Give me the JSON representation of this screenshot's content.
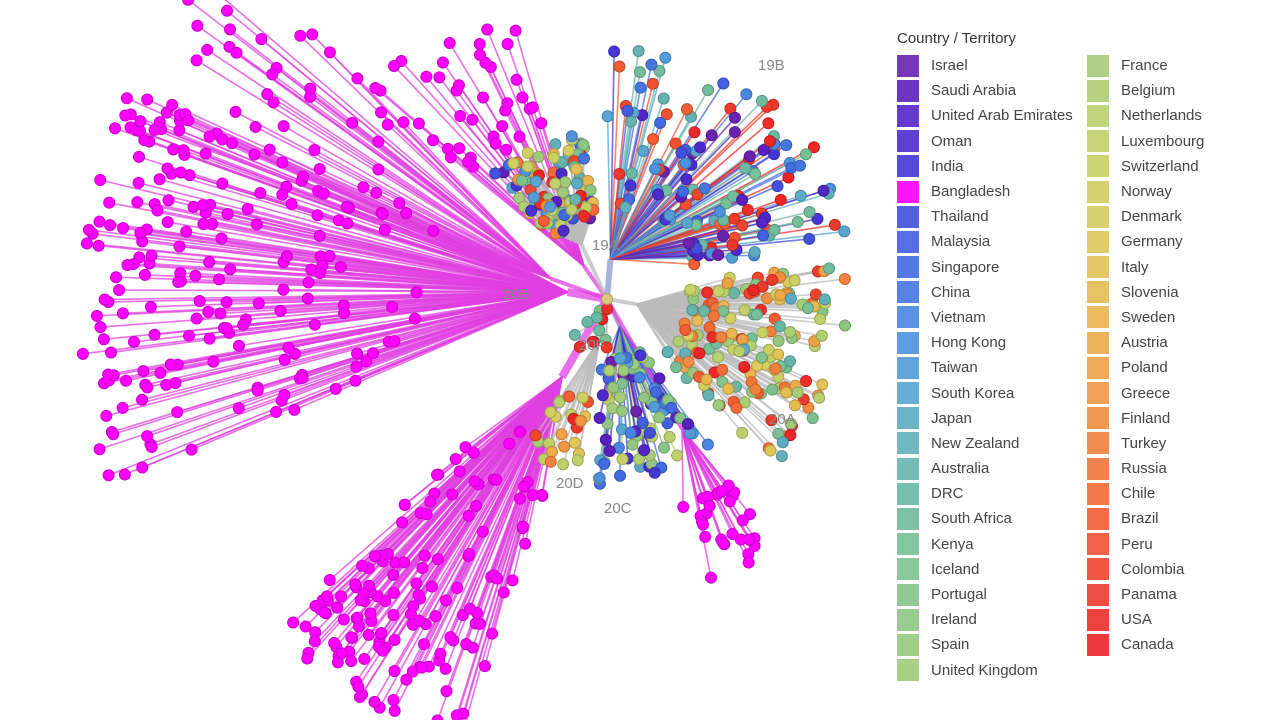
{
  "legend": {
    "title": "Country / Territory",
    "columns": [
      [
        {
          "label": "Israel",
          "color": "#6a22b0"
        },
        {
          "label": "Saudi Arabia",
          "color": "#5b1fbd"
        },
        {
          "label": "United Arab Emirates",
          "color": "#5426c5"
        },
        {
          "label": "Oman",
          "color": "#4b2ccb"
        },
        {
          "label": "India",
          "color": "#4637d4"
        },
        {
          "label": "Bangladesh",
          "color": "#ff00ff"
        },
        {
          "label": "Thailand",
          "color": "#4250db"
        },
        {
          "label": "Malaysia",
          "color": "#435fe0"
        },
        {
          "label": "Singapore",
          "color": "#436ae2"
        },
        {
          "label": "China",
          "color": "#4577df"
        },
        {
          "label": "Vietnam",
          "color": "#4a86e0"
        },
        {
          "label": "Hong Kong",
          "color": "#4e92de"
        },
        {
          "label": "Taiwan",
          "color": "#539cd8"
        },
        {
          "label": "South Korea",
          "color": "#58a5d0"
        },
        {
          "label": "Japan",
          "color": "#5dabc4"
        },
        {
          "label": "New Zealand",
          "color": "#62b0b8"
        },
        {
          "label": "Australia",
          "color": "#66b4ad"
        },
        {
          "label": "DRC",
          "color": "#6bb9a5"
        },
        {
          "label": "South Africa",
          "color": "#70bc9d"
        },
        {
          "label": "Kenya",
          "color": "#77bf96"
        },
        {
          "label": "Iceland",
          "color": "#7ec18f"
        },
        {
          "label": "Portugal",
          "color": "#86c489"
        },
        {
          "label": "Ireland",
          "color": "#8ec784"
        },
        {
          "label": "Spain",
          "color": "#96c97f"
        },
        {
          "label": "United Kingdom",
          "color": "#9fcb7b"
        }
      ],
      [
        {
          "label": "France",
          "color": "#a8cd77"
        },
        {
          "label": "Belgium",
          "color": "#b0cf72"
        },
        {
          "label": "Netherlands",
          "color": "#b9d06e"
        },
        {
          "label": "Luxembourg",
          "color": "#c1d16a"
        },
        {
          "label": "Switzerland",
          "color": "#c9d166"
        },
        {
          "label": "Norway",
          "color": "#d0cf62"
        },
        {
          "label": "Denmark",
          "color": "#d7cc5e"
        },
        {
          "label": "Germany",
          "color": "#ddc85a"
        },
        {
          "label": "Italy",
          "color": "#e2c256"
        },
        {
          "label": "Slovenia",
          "color": "#e6bb52"
        },
        {
          "label": "Sweden",
          "color": "#eab44e"
        },
        {
          "label": "Austria",
          "color": "#edab4a"
        },
        {
          "label": "Poland",
          "color": "#efa146"
        },
        {
          "label": "Greece",
          "color": "#f09743"
        },
        {
          "label": "Finland",
          "color": "#f18c40"
        },
        {
          "label": "Turkey",
          "color": "#f2813d"
        },
        {
          "label": "Russia",
          "color": "#f2763a"
        },
        {
          "label": "Chile",
          "color": "#f26a37"
        },
        {
          "label": "Brazil",
          "color": "#f15e34"
        },
        {
          "label": "Peru",
          "color": "#f05231"
        },
        {
          "label": "Colombia",
          "color": "#ef462e"
        },
        {
          "label": "Panama",
          "color": "#ee3a2b"
        },
        {
          "label": "USA",
          "color": "#ed2e28"
        },
        {
          "label": "Canada",
          "color": "#ec2626"
        }
      ]
    ]
  },
  "tree": {
    "layout": "radial",
    "color_by": "Country / Territory",
    "clades": [
      "19A",
      "19B",
      "20A",
      "20B",
      "20C",
      "20D",
      "20F"
    ]
  }
}
